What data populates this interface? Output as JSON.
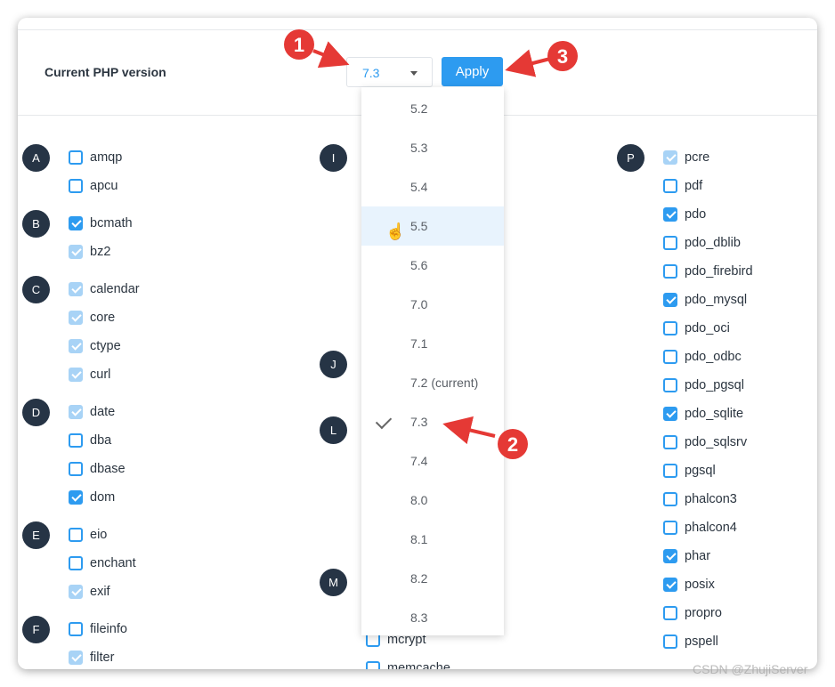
{
  "header": {
    "title": "Current PHP version",
    "selected_version": "7.3",
    "apply_label": "Apply"
  },
  "dropdown": {
    "options": [
      "5.2",
      "5.3",
      "5.4",
      "5.5",
      "5.6",
      "7.0",
      "7.1",
      "7.2 (current)",
      "7.3",
      "7.4",
      "8.0",
      "8.1",
      "8.2",
      "8.3"
    ],
    "hovered": "5.5",
    "selected": "7.3"
  },
  "left_column": {
    "groups": [
      {
        "letter": "A"
      },
      {
        "letter": "B"
      },
      {
        "letter": "C"
      },
      {
        "letter": "D"
      },
      {
        "letter": "E"
      },
      {
        "letter": "F"
      }
    ],
    "items": [
      {
        "label": "amqp",
        "state": "unchecked"
      },
      {
        "label": "apcu",
        "state": "unchecked"
      },
      {
        "label": "bcmath",
        "state": "checked"
      },
      {
        "label": "bz2",
        "state": "checked-disabled"
      },
      {
        "label": "calendar",
        "state": "checked-disabled"
      },
      {
        "label": "core",
        "state": "checked-disabled"
      },
      {
        "label": "ctype",
        "state": "checked-disabled"
      },
      {
        "label": "curl",
        "state": "checked-disabled"
      },
      {
        "label": "date",
        "state": "checked-disabled"
      },
      {
        "label": "dba",
        "state": "unchecked"
      },
      {
        "label": "dbase",
        "state": "unchecked"
      },
      {
        "label": "dom",
        "state": "checked"
      },
      {
        "label": "eio",
        "state": "unchecked"
      },
      {
        "label": "enchant",
        "state": "unchecked"
      },
      {
        "label": "exif",
        "state": "checked-disabled"
      },
      {
        "label": "fileinfo",
        "state": "unchecked"
      },
      {
        "label": "filter",
        "state": "checked-disabled"
      }
    ]
  },
  "middle_column": {
    "groups": [
      {
        "letter": "I"
      },
      {
        "letter": "J"
      },
      {
        "letter": "L"
      },
      {
        "letter": "M"
      }
    ],
    "items": [
      {
        "label": "mcrypt",
        "state": "unchecked"
      },
      {
        "label": "memcache",
        "state": "unchecked"
      }
    ]
  },
  "right_column": {
    "groups": [
      {
        "letter": "P"
      }
    ],
    "items": [
      {
        "label": "pcre",
        "state": "checked-disabled"
      },
      {
        "label": "pdf",
        "state": "unchecked"
      },
      {
        "label": "pdo",
        "state": "checked"
      },
      {
        "label": "pdo_dblib",
        "state": "unchecked"
      },
      {
        "label": "pdo_firebird",
        "state": "unchecked"
      },
      {
        "label": "pdo_mysql",
        "state": "checked"
      },
      {
        "label": "pdo_oci",
        "state": "unchecked"
      },
      {
        "label": "pdo_odbc",
        "state": "unchecked"
      },
      {
        "label": "pdo_pgsql",
        "state": "unchecked"
      },
      {
        "label": "pdo_sqlite",
        "state": "checked"
      },
      {
        "label": "pdo_sqlsrv",
        "state": "unchecked"
      },
      {
        "label": "pgsql",
        "state": "unchecked"
      },
      {
        "label": "phalcon3",
        "state": "unchecked"
      },
      {
        "label": "phalcon4",
        "state": "unchecked"
      },
      {
        "label": "phar",
        "state": "checked"
      },
      {
        "label": "posix",
        "state": "checked"
      },
      {
        "label": "propro",
        "state": "unchecked"
      },
      {
        "label": "pspell",
        "state": "unchecked"
      }
    ]
  },
  "annotations": [
    "1",
    "2",
    "3"
  ],
  "watermark": "CSDN @ZhujiServer",
  "colors": {
    "accent": "#2d9bf0",
    "badge": "#263445",
    "annotation": "#e53935"
  }
}
